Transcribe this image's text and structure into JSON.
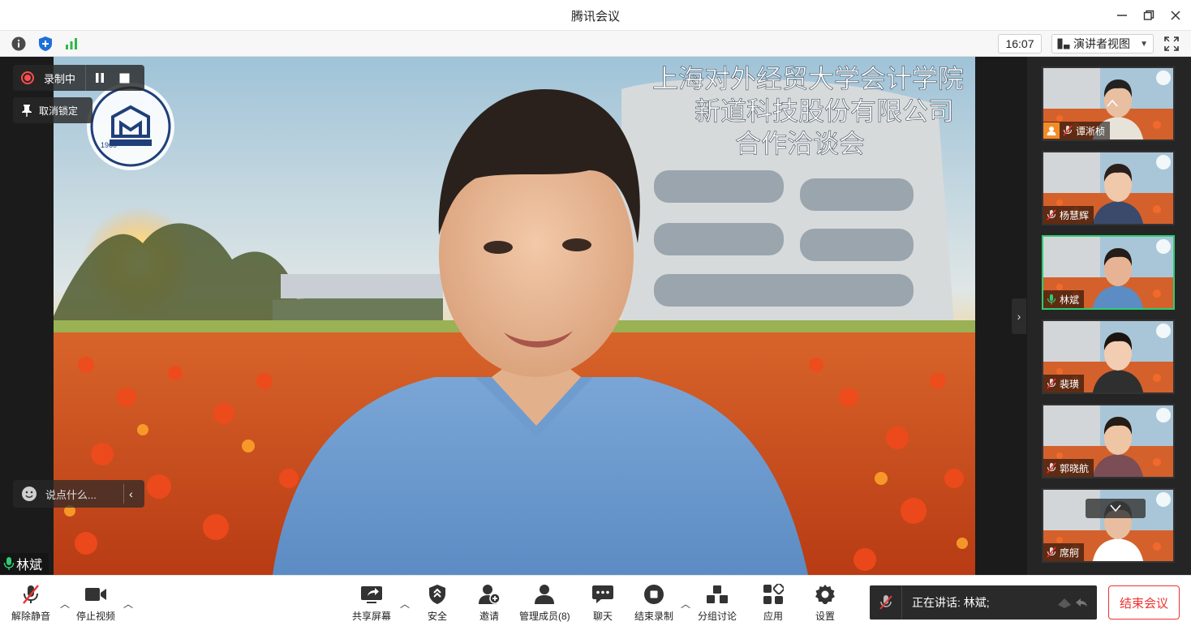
{
  "window": {
    "title": "腾讯会议",
    "minimize_icon": "minimize-icon",
    "restore_icon": "restore-icon",
    "close_icon": "close-icon"
  },
  "toolbar": {
    "clock": "16:07",
    "view_mode": "演讲者视图",
    "icons": [
      "info-icon",
      "shield-icon",
      "signal-icon",
      "fullscreen-icon"
    ]
  },
  "stage": {
    "recording_label": "录制中",
    "unpin_label": "取消锁定",
    "chat_placeholder": "说点什么...",
    "chat_collapse": "‹",
    "active_speaker_name": "林斌",
    "background_banner": [
      "上海对外经贸大学会计学院",
      "新道科技股份有限公司",
      "合作洽谈会"
    ],
    "logo_year": "1960",
    "accent": "#ff4d4d"
  },
  "participants": [
    {
      "name": "谭淅桢",
      "muted": true,
      "host": true
    },
    {
      "name": "杨慧辉",
      "muted": true,
      "host": false
    },
    {
      "name": "林斌",
      "muted": false,
      "host": false,
      "active": true
    },
    {
      "name": "裴璜",
      "muted": true,
      "host": false
    },
    {
      "name": "郭晓航",
      "muted": true,
      "host": false
    },
    {
      "name": "席舸",
      "muted": true,
      "host": false
    }
  ],
  "bottom": {
    "unmute": "解除静音",
    "stop_video": "停止视频",
    "share_screen": "共享屏幕",
    "security": "安全",
    "invite": "邀请",
    "members": "管理成员(8)",
    "chat": "聊天",
    "end_record": "结束录制",
    "breakout": "分组讨论",
    "apps": "应用",
    "settings": "设置",
    "speaking_label": "正在讲话: 林斌;",
    "end_meeting": "结束会议",
    "end_color": "#ee3333"
  }
}
